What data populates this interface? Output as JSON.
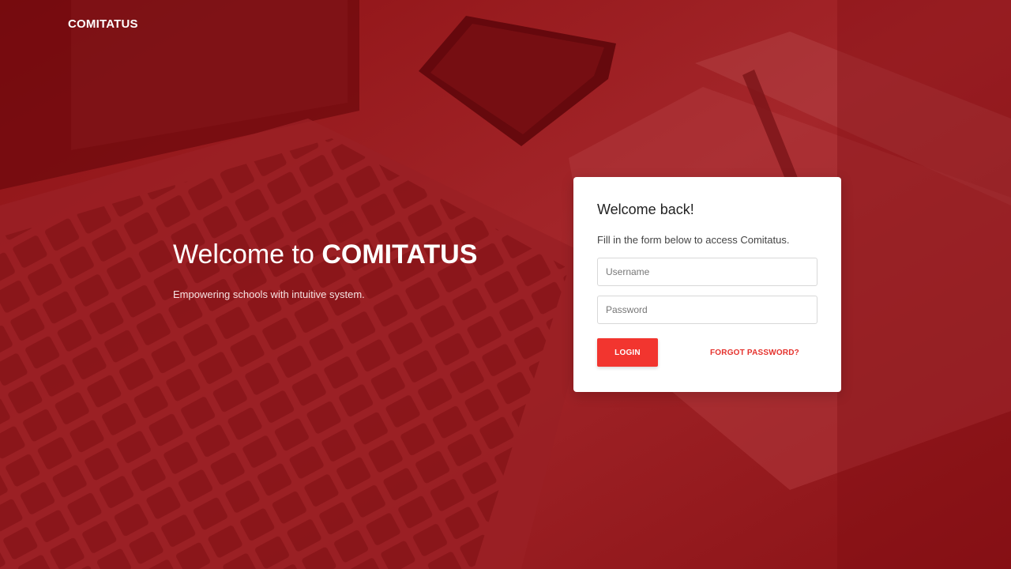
{
  "brand": {
    "logo_text": "COMITATUS"
  },
  "hero": {
    "title_prefix": "Welcome to ",
    "title_brand": "COMITATUS",
    "subtitle": "Empowering schools with intuitive system."
  },
  "login_card": {
    "title": "Welcome back!",
    "description": "Fill in the form below to access Comitatus.",
    "username_placeholder": "Username",
    "password_placeholder": "Password",
    "login_label": "LOGIN",
    "forgot_label": "FORGOT PASSWORD?"
  },
  "colors": {
    "background_tint": "#a3171b",
    "accent": "#f2352f",
    "link": "#e5322d",
    "card_bg": "#ffffff"
  }
}
